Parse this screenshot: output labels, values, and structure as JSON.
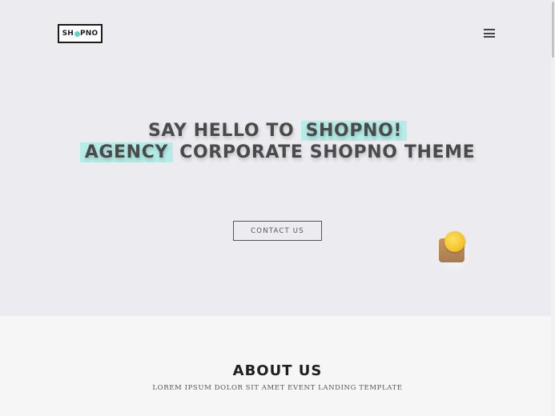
{
  "header": {
    "logo_text_pre": "SH",
    "logo_text_post": "PNO",
    "menu_icon": "hamburger-menu-icon"
  },
  "hero": {
    "line1_pre": "SAY HELLO TO ",
    "line1_highlight": "SHOPNO!",
    "line2_highlight": "AGENCY",
    "line2_post": " CORPORATE SHOPNO THEME",
    "cta_label": "CONTACT US",
    "decor_icon": "coin-stack-icon"
  },
  "about": {
    "title": "ABOUT US",
    "subtitle": "LOREM IPSUM DOLOR SIT AMET EVENT LANDING TEMPLATE"
  },
  "colors": {
    "highlight": "#b5ece7",
    "accent_dot": "#5fd3c9",
    "hero_bg": "#ecebef",
    "about_bg": "#f6f6f6"
  }
}
